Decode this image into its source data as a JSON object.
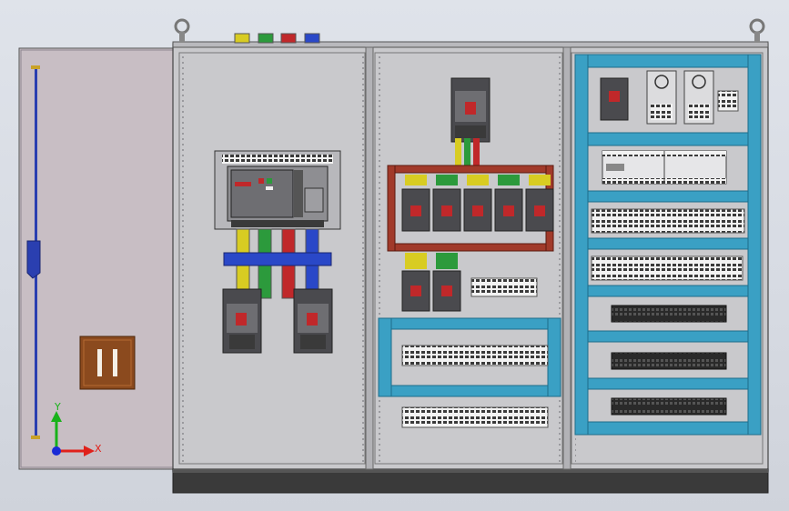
{
  "axis_triad": {
    "x_label": "X",
    "y_label": "Y",
    "x_color": "#e0201a",
    "y_color": "#18b21a",
    "origin_color": "#1a2bd6"
  },
  "colors": {
    "cabinet_gray": "#c9c9cc",
    "door_pink": "#c8bec4",
    "plinth": "#3a3a3a",
    "busbar_brown": "#a13a2a",
    "rail_blue": "#3aa0c4",
    "phase_yellow": "#d8cc22",
    "phase_green": "#2c9a3c",
    "phase_red": "#c0282a",
    "phase_blue": "#2a48c8",
    "rod_blue": "#2a3fb0",
    "handle_brown": "#8b4a1e"
  },
  "phase_terminals": [
    "yellow",
    "green",
    "red",
    "blue"
  ],
  "counts": {
    "branch_breakers_top_row": 5,
    "branch_breakers_bottom_row": 2,
    "incoming_outgoing_breakers": 2,
    "power_supplies": 2,
    "relay_modules_per_row": 10,
    "terminal_block_rows": 3
  }
}
